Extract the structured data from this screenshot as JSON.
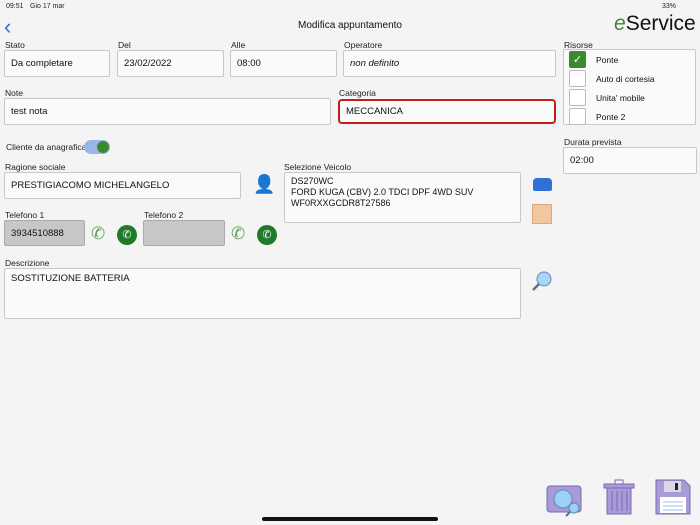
{
  "status_bar": {
    "time": "09:51",
    "date": "Gio 17 mar",
    "battery": "33%"
  },
  "header": {
    "title": "Modifica appuntamento",
    "logo": "eService"
  },
  "fields": {
    "stato": {
      "label": "Stato",
      "value": "Da completare"
    },
    "del": {
      "label": "Del",
      "value": "23/02/2022"
    },
    "alle": {
      "label": "Alle",
      "value": "08:00"
    },
    "operatore": {
      "label": "Operatore",
      "value": "non definito"
    },
    "note": {
      "label": "Note",
      "value": "test nota"
    },
    "categoria": {
      "label": "Categoria",
      "value": "MECCANICA"
    },
    "cliente_toggle": {
      "label": "Cliente da anagrafica",
      "on": true
    },
    "ragione_sociale": {
      "label": "Ragione sociale",
      "value": "PRESTIGIACOMO MICHELANGELO"
    },
    "veicolo": {
      "label": "Selezione Veicolo",
      "lines": [
        "DS270WC",
        "FORD KUGA (CBV) 2.0 TDCI DPF 4WD SUV",
        "WF0RXXGCDR8T27586"
      ]
    },
    "telefono1": {
      "label": "Telefono 1",
      "value": "3934510888"
    },
    "telefono2": {
      "label": "Telefono 2",
      "value": ""
    },
    "descrizione": {
      "label": "Descrizione",
      "value": "SOSTITUZIONE BATTERIA"
    },
    "durata": {
      "label": "Durata prevista",
      "value": "02:00"
    }
  },
  "risorse": {
    "label": "Risorse",
    "items": [
      {
        "label": "Ponte",
        "checked": true
      },
      {
        "label": "Auto di cortesia",
        "checked": false
      },
      {
        "label": "Unita' mobile",
        "checked": false
      },
      {
        "label": "Ponte 2",
        "checked": false
      }
    ]
  },
  "colors": {
    "accent": "#3c8a30",
    "error": "#c0201c",
    "icon": "#a99ad8"
  }
}
